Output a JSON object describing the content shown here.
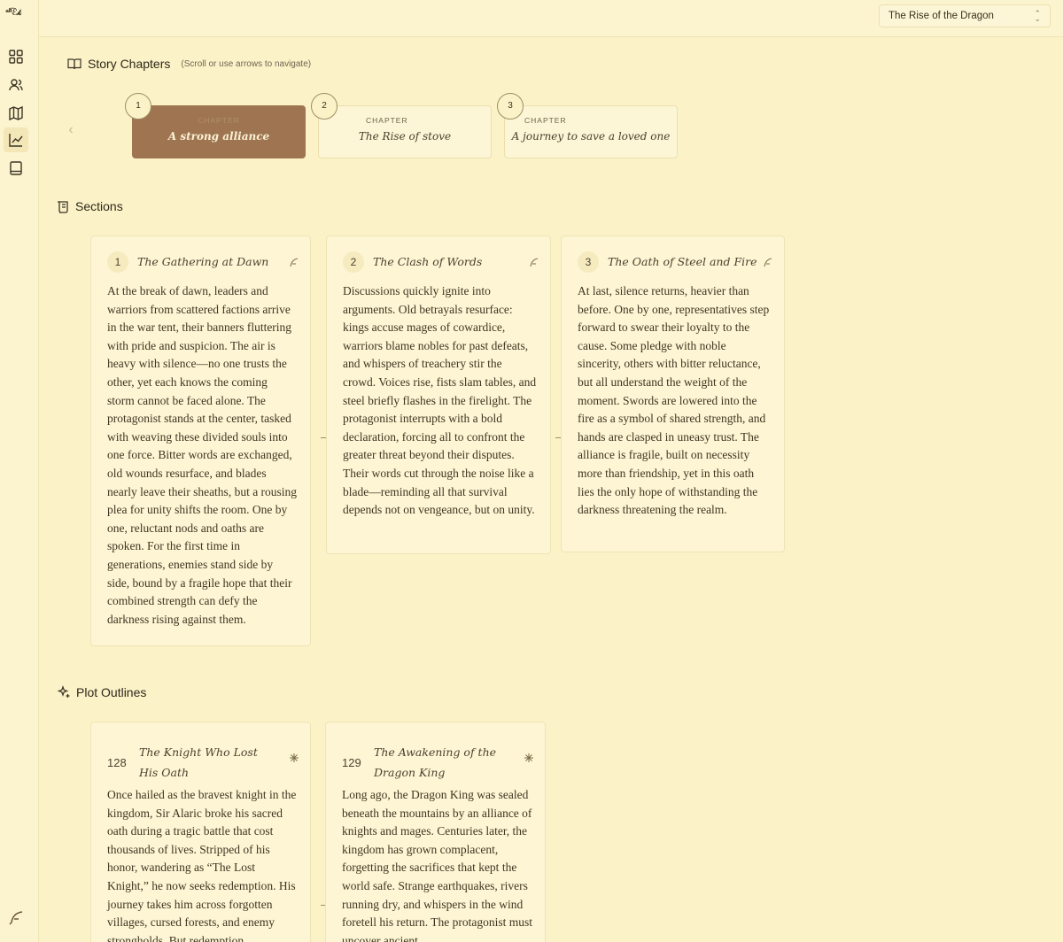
{
  "app": {
    "logo_text": "ᵃᴿ͡ℰ𝓀"
  },
  "rail": {
    "items": [
      {
        "icon": "dashboard-icon"
      },
      {
        "icon": "users-icon"
      },
      {
        "icon": "map-icon"
      },
      {
        "icon": "chart-icon"
      },
      {
        "icon": "book-icon"
      }
    ],
    "bottom_icon": "feather-icon"
  },
  "header": {
    "story_select": {
      "value": "The Rise of the Dragon"
    }
  },
  "chapters": {
    "title": "Story Chapters",
    "hint": "(Scroll or use arrows to navigate)",
    "items": [
      {
        "number": "1",
        "kicker": "CHAPTER",
        "name": "A strong alliance",
        "active": true
      },
      {
        "number": "2",
        "kicker": "CHAPTER",
        "name": "The Rise of stove",
        "active": false
      },
      {
        "number": "3",
        "kicker": "CHAPTER",
        "name": "A journey to save a loved one",
        "active": false
      }
    ]
  },
  "sections": {
    "title": "Sections",
    "items": [
      {
        "number": "1",
        "title": "The Gathering at Dawn",
        "body": "At the break of dawn, leaders and warriors from scattered factions arrive in the war tent, their banners fluttering with pride and suspicion. The air is heavy with silence—no one trusts the other, yet each knows the coming storm cannot be faced alone. The protagonist stands at the center, tasked with weaving these divided souls into one force. Bitter words are exchanged, old wounds resurface, and blades nearly leave their sheaths, but a rousing plea for unity shifts the room. One by one, reluctant nods and oaths are spoken. For the first time in generations, enemies stand side by side, bound by a fragile hope that their combined strength can defy the darkness rising against them."
      },
      {
        "number": "2",
        "title": "The Clash of Words",
        "body": "Discussions quickly ignite into arguments. Old betrayals resurface: kings accuse mages of cowardice, warriors blame nobles for past defeats, and whispers of treachery stir the crowd. Voices rise, fists slam tables, and steel briefly flashes in the firelight. The protagonist interrupts with a bold declaration, forcing all to confront the greater threat beyond their disputes. Their words cut through the noise like a blade—reminding all that survival depends not on vengeance, but on unity."
      },
      {
        "number": "3",
        "title": "The Oath of Steel and Fire",
        "body": "At last, silence returns, heavier than before. One by one, representatives step forward to swear their loyalty to the cause. Some pledge with noble sincerity, others with bitter reluctance, but all understand the weight of the moment. Swords are lowered into the fire as a symbol of shared strength, and hands are clasped in uneasy trust. The alliance is fragile, built on necessity more than friendship, yet in this oath lies the only hope of withstanding the darkness threatening the realm."
      }
    ]
  },
  "plots": {
    "title": "Plot Outlines",
    "items": [
      {
        "number": "128",
        "title": "The Knight Who Lost His Oath",
        "body": "Once hailed as the bravest knight in the kingdom, Sir Alaric broke his sacred oath during a tragic battle that cost thousands of lives. Stripped of his honor, wandering as “The Lost Knight,” he now seeks redemption. His journey takes him across forgotten villages, cursed forests, and enemy strongholds. But redemption"
      },
      {
        "number": "129",
        "title": "The Awakening of the Dragon King",
        "body": "Long ago, the Dragon King was sealed beneath the mountains by an alliance of knights and mages. Centuries later, the kingdom has grown complacent, forgetting the sacrifices that kept the world safe. Strange earthquakes, rivers running dry, and whispers in the wind foretell his return. The protagonist must uncover ancient"
      }
    ]
  }
}
